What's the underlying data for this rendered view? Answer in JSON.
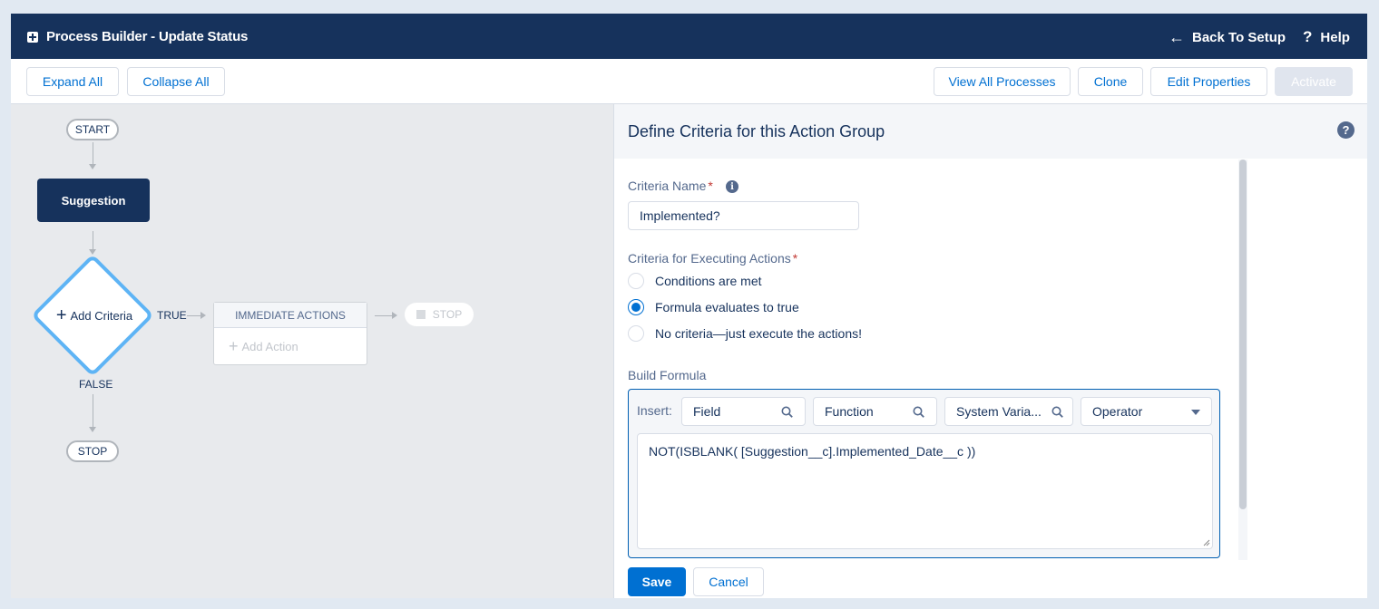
{
  "header": {
    "title": "Process Builder - Update Status",
    "back_label": "Back To Setup",
    "help_label": "Help"
  },
  "toolbar": {
    "expand_all": "Expand All",
    "collapse_all": "Collapse All",
    "view_all_processes": "View All Processes",
    "clone": "Clone",
    "edit_properties": "Edit Properties",
    "activate": "Activate"
  },
  "canvas": {
    "start": "START",
    "object_node": "Suggestion",
    "add_criteria": "Add Criteria",
    "true_label": "TRUE",
    "false_label": "FALSE",
    "immediate_actions": "IMMEDIATE ACTIONS",
    "add_action": "Add Action",
    "stop_right": "STOP",
    "stop_bottom": "STOP"
  },
  "panel": {
    "title": "Define Criteria for this Action Group",
    "criteria_name_label": "Criteria Name",
    "criteria_name_value": "Implemented?",
    "criteria_exec_label": "Criteria for Executing Actions",
    "radio_options": [
      {
        "label": "Conditions are met",
        "checked": false
      },
      {
        "label": "Formula evaluates to true",
        "checked": true
      },
      {
        "label": "No criteria—just execute the actions!",
        "checked": false
      }
    ],
    "build_formula_label": "Build Formula",
    "insert_label": "Insert:",
    "insert_field": "Field",
    "insert_function": "Function",
    "insert_system_variable": "System Varia...",
    "insert_operator": "Operator",
    "formula": "NOT(ISBLANK( [Suggestion__c].Implemented_Date__c ))",
    "save": "Save",
    "cancel": "Cancel"
  },
  "colors": {
    "header_bg": "#16325c",
    "brand_blue": "#0070d2",
    "criteria_border": "#5eb4f5",
    "required": "#c23934"
  }
}
